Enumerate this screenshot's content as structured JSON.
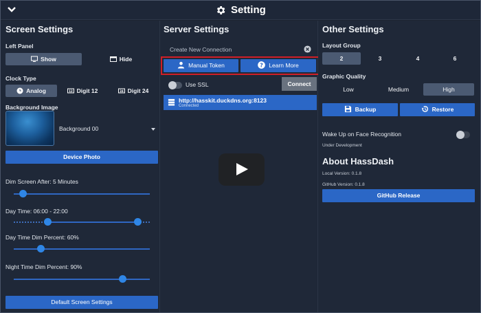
{
  "header": {
    "title": "Setting",
    "collapse_icon": "chevron-down-icon",
    "settings_icon": "gear-icon"
  },
  "screen_settings": {
    "title": "Screen Settings",
    "left_panel": {
      "label": "Left Panel",
      "options": [
        "Show",
        "Hide"
      ],
      "selected": "Show"
    },
    "clock_type": {
      "label": "Clock Type",
      "options": [
        "Analog",
        "Digit 12",
        "Digit 24"
      ],
      "selected": "Analog"
    },
    "background_image": {
      "label": "Background Image",
      "value": "Background 00"
    },
    "device_photo_button": "Device Photo",
    "dim_screen_after": {
      "label": "Dim Screen After: 5 Minutes",
      "fraction": 0.07
    },
    "day_time": {
      "label": "Day Time: 06:00 - 22:00",
      "start_fraction": 0.25,
      "end_fraction": 0.91
    },
    "day_time_dim": {
      "label": "Day Time Dim Percent: 60%",
      "fraction": 0.2
    },
    "night_time_dim": {
      "label": "Night Time Dim Percent: 90%",
      "fraction": 0.8
    },
    "default_button": "Default Screen Settings"
  },
  "server_settings": {
    "title": "Server Settings",
    "new_connection_placeholder": "Create New Connection",
    "manual_token_button": "Manual Token",
    "learn_more_button": "Learn More",
    "use_ssl_label": "Use SSL",
    "use_ssl_on": false,
    "connect_button": "Connect",
    "connection": {
      "url": "http://hasskit.duckdns.org:8123",
      "status": "Connected"
    }
  },
  "other_settings": {
    "title": "Other Settings",
    "layout_group": {
      "label": "Layout Group",
      "options": [
        "2",
        "3",
        "4",
        "6"
      ],
      "selected": "2"
    },
    "graphic_quality": {
      "label": "Graphic Quality",
      "options": [
        "Low",
        "Medium",
        "High"
      ],
      "selected": "High"
    },
    "backup_button": "Backup",
    "restore_button": "Restore",
    "wake_up": {
      "label": "Wake Up on Face Recognition",
      "note": "Under Development",
      "on": false
    },
    "about": {
      "title": "About HassDash",
      "local_version": "Local Version: 0.1.8",
      "github_version": "GitHub Version: 0.1.8",
      "github_release_button": "GitHub Release"
    }
  },
  "video_overlay": {
    "play_icon": "play-icon"
  },
  "colors": {
    "accent": "#2b67c6",
    "highlight_box": "#d11f27",
    "background": "#1f2838"
  }
}
